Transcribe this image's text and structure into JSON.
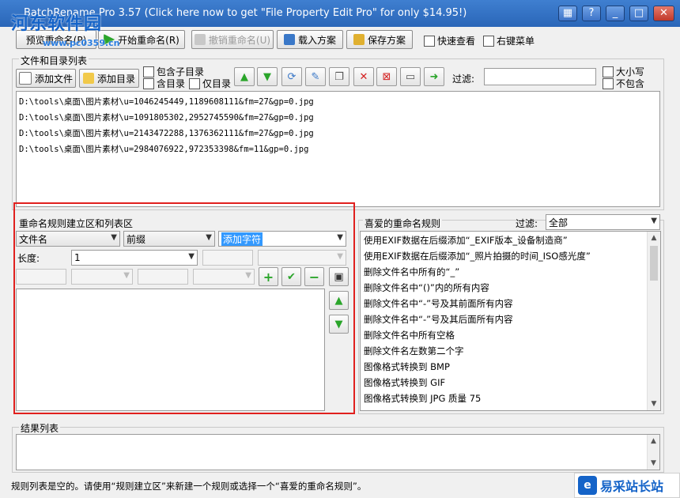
{
  "window": {
    "title": "BatchRename Pro 3.57  (Click here now to get \"File Property Edit Pro\" for only $14.95!)",
    "controls": {
      "minimize": "_",
      "maximize": "□",
      "close": "✕"
    }
  },
  "watermark": {
    "logo_text": "河东软件园",
    "url": "www.pc0359.cn"
  },
  "toolbar": {
    "preview_label": "预览重命名(P)",
    "start_label": "开始重命名(R)",
    "undo_label": "撤销重命名(U)",
    "load_label": "载入方案",
    "save_label": "保存方案",
    "quick_view_label": "快速查看",
    "context_menu_label": "右键菜单"
  },
  "files_section": {
    "title": "文件和目录列表",
    "add_file_label": "添加文件",
    "add_dir_label": "添加目录",
    "include_subdirs_label": "包含子目录",
    "with_dir_label": "含目录",
    "only_dir_label": "仅目录",
    "filter_label": "过滤:",
    "filter_value": "",
    "case_label": "大小写",
    "exclude_label": "不包含",
    "files": [
      "D:\\tools\\桌面\\图片素材\\u=1046245449,1189608111&fm=27&gp=0.jpg",
      "D:\\tools\\桌面\\图片素材\\u=1091805302,2952745590&fm=27&gp=0.jpg",
      "D:\\tools\\桌面\\图片素材\\u=2143472288,1376362111&fm=27&gp=0.jpg",
      "D:\\tools\\桌面\\图片素材\\u=2984076922,972353398&fm=11&gp=0.jpg"
    ]
  },
  "rule_section": {
    "title": "重命名规则建立区和列表区",
    "target_value": "文件名",
    "position_value": "前缀",
    "text_value": "添加字符",
    "length_label": "长度:",
    "length_value": "1"
  },
  "favorites": {
    "title": "喜爱的重命名规则",
    "filter_label": "过滤:",
    "filter_value": "全部",
    "items": [
      "使用EXIF数据在后缀添加“_EXIF版本_设备制造商”",
      "使用EXIF数据在后缀添加“_照片拍摄的时间_ISO感光度”",
      "删除文件名中所有的“_”",
      "删除文件名中“()”内的所有内容",
      "删除文件名中“-”号及其前面所有内容",
      "删除文件名中“-”号及其后面所有内容",
      "删除文件名中所有空格",
      "删除文件名左数第二个字",
      "图像格式转换到 BMP",
      "图像格式转换到 GIF",
      "图像格式转换到 JPG 质量 75"
    ]
  },
  "results": {
    "title": "结果列表"
  },
  "status": {
    "text": "规则列表是空的。请使用“规则建立区”来新建一个规则或选择一个“喜爱的重命名规则”。",
    "badge": "易采站长站"
  },
  "colors": {
    "highlight": "#e0201e",
    "selection": "#3399ff",
    "titlebar": "#2a66b8"
  }
}
